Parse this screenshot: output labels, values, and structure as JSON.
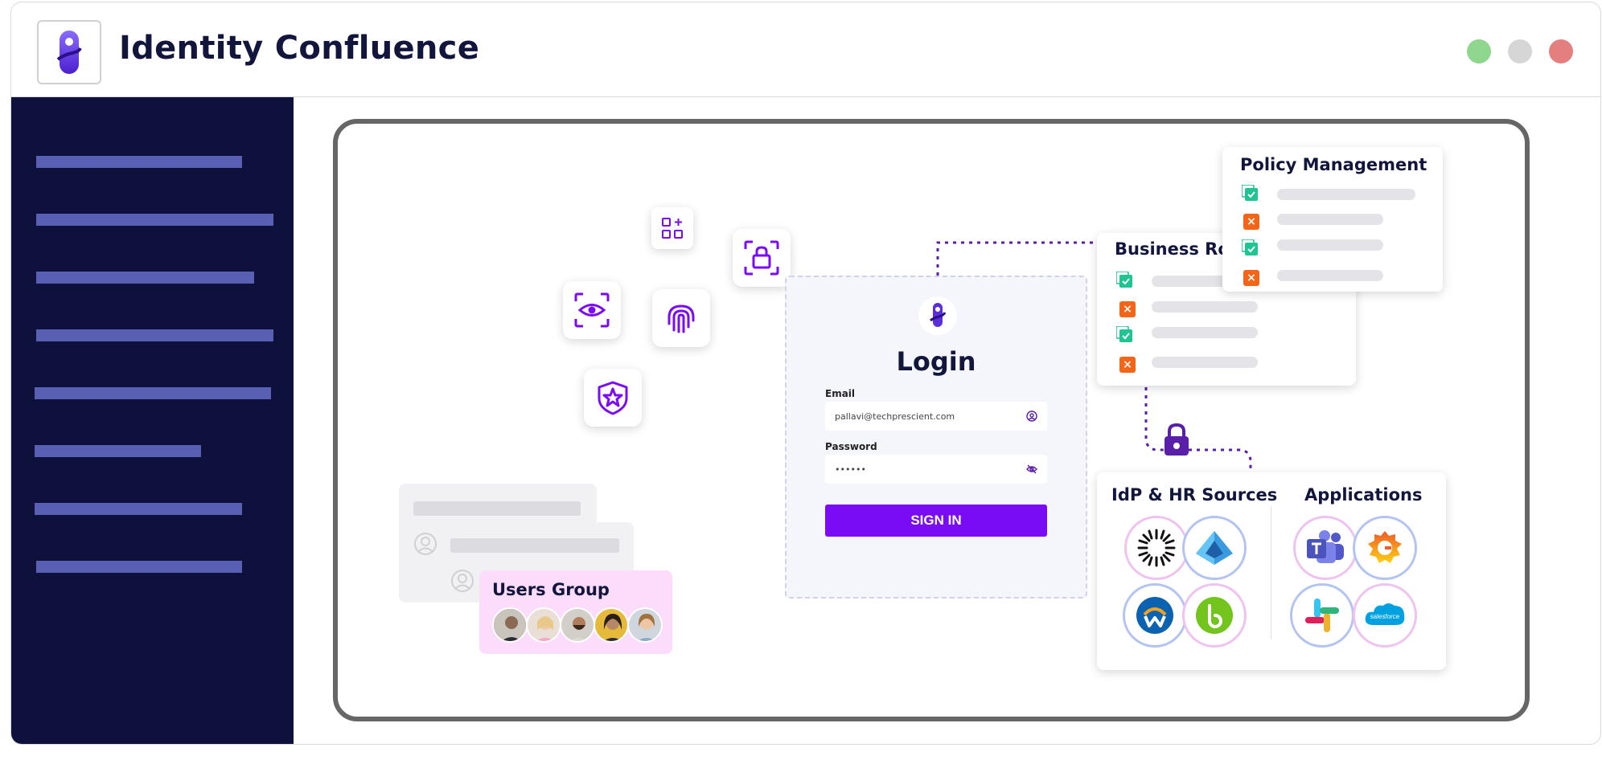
{
  "app": {
    "title": "Identity Confluence"
  },
  "window_controls": [
    {
      "name": "maximize",
      "color": "#8fd68f"
    },
    {
      "name": "minimize",
      "color": "#d6d6d6"
    },
    {
      "name": "close",
      "color": "#e37f7f"
    }
  ],
  "login": {
    "title": "Login",
    "email_label": "Email",
    "email_value": "pallavi@techprescient.com",
    "password_label": "Password",
    "password_value": "••••••",
    "signin_label": "SIGN IN"
  },
  "panels": {
    "business_roles": "Business Roles",
    "policy_management": "Policy Management",
    "idp_sources": "IdP & HR Sources",
    "applications": "Applications",
    "users_group": "Users Group"
  },
  "colors": {
    "sidebar": "#0d113b",
    "sidebar_item": "#5960b4",
    "accent": "#7a0cf5",
    "title": "#12163d",
    "check": "#1fc493",
    "cross": "#f36619",
    "users_group_bg": "#fbdcfb"
  },
  "icons": [
    "app-logo-icon",
    "apps-icon",
    "lock-scan-icon",
    "eye-scan-icon",
    "fingerprint-icon",
    "shield-star-icon",
    "user-circle-icon",
    "eye-off-icon",
    "padlock-icon",
    "check-icon",
    "cross-icon",
    "avatar-icon",
    "okta-icon",
    "azure-ad-icon",
    "workday-icon",
    "bamboohr-icon",
    "teams-icon",
    "grafana-icon",
    "slack-icon",
    "salesforce-icon"
  ],
  "integrations": {
    "idp": [
      "okta",
      "azure-ad",
      "workday",
      "bamboohr"
    ],
    "apps": [
      "teams",
      "grafana",
      "slack",
      "salesforce"
    ],
    "salesforce_text": "salesforce"
  }
}
